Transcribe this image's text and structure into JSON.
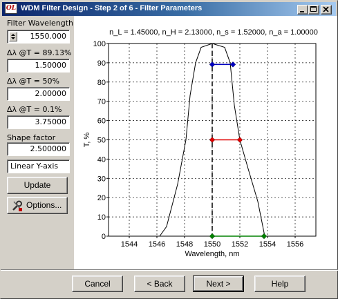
{
  "window": {
    "title": "WDM Filter Design - Step 2 of 6 - Filter Parameters",
    "app_icon_text": "OL"
  },
  "left_panel": {
    "filter_wavelength": {
      "label": "Filter Wavelength:",
      "value": "1550.000"
    },
    "bw_8913": {
      "label": "Δλ @T = 89.13%",
      "value": "1.50000"
    },
    "bw_50": {
      "label": "Δλ @T = 50%",
      "value": "2.00000"
    },
    "bw_01": {
      "label": "Δλ @T = 0.1%",
      "value": "3.75000"
    },
    "shape_factor": {
      "label": "Shape factor",
      "value": "2.500000"
    },
    "axis_mode": {
      "value": "Linear Y-axis"
    },
    "update_label": "Update",
    "options_label": "Options..."
  },
  "footer": {
    "cancel_label": "Cancel",
    "back_label": "< Back",
    "next_label": "Next >",
    "help_label": "Help"
  },
  "chart_data": {
    "type": "line",
    "title": "n_L = 1.45000, n_H = 2.13000, n_s = 1.52000, n_a = 1.00000",
    "xlabel": "Wavelength, nm",
    "ylabel": "T, %",
    "xlim": [
      1542.5,
      1557.5
    ],
    "ylim": [
      0,
      100
    ],
    "x_ticks": [
      "1544",
      "1546",
      "1548",
      "1550",
      "1552",
      "1554",
      "1556"
    ],
    "y_ticks": [
      "0",
      "10",
      "20",
      "30",
      "40",
      "50",
      "60",
      "70",
      "80",
      "90",
      "100"
    ],
    "grid": true,
    "series": [
      {
        "color": "#000000",
        "x": [
          1546.2,
          1546.7,
          1547.5,
          1548.1,
          1548.4,
          1548.8,
          1549.2,
          1550,
          1550.9,
          1551.3,
          1551.6,
          1552.0,
          1552.6,
          1553.3,
          1553.8
        ],
        "y": [
          0,
          5,
          27,
          50,
          73,
          90,
          98,
          100,
          98,
          90,
          68,
          50,
          35,
          18,
          0
        ]
      }
    ],
    "markers": [
      {
        "color": "#0000c0",
        "x1": 1550.0,
        "x2": 1551.5,
        "y": 89.13
      },
      {
        "color": "#e00000",
        "x1": 1550.0,
        "x2": 1552.0,
        "y": 50
      },
      {
        "color": "#008000",
        "x1": 1550.0,
        "x2": 1553.75,
        "y": 0
      }
    ],
    "center_line_x": 1550
  }
}
